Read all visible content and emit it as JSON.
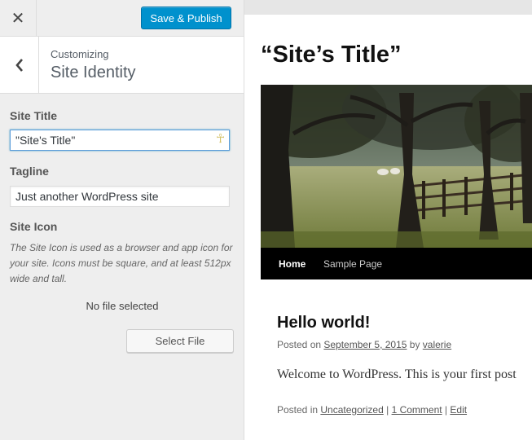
{
  "sidebar": {
    "close_icon": "close-icon",
    "publish_label": "Save & Publish",
    "back_icon": "chevron-left-icon",
    "customizing_label": "Customizing",
    "section_title": "Site Identity",
    "site_title": {
      "label": "Site Title",
      "value": "\"Site's Title\""
    },
    "tagline": {
      "label": "Tagline",
      "value": "Just another WordPress site"
    },
    "site_icon": {
      "label": "Site Icon",
      "description": "The Site Icon is used as a browser and app icon for your site. Icons must be square, and at least 512px wide and tall.",
      "status": "No file selected",
      "button_label": "Select File"
    }
  },
  "preview": {
    "site_heading": "“Site’s Title”",
    "nav": [
      "Home",
      "Sample Page"
    ],
    "post": {
      "title": "Hello world!",
      "meta_prefix": "Posted on ",
      "date": "September 5, 2015",
      "meta_by": " by ",
      "author": "valerie",
      "body": "Welcome to WordPress. This is your first post",
      "footer_prefix": "Posted in ",
      "category": "Uncategorized",
      "sep1": " | ",
      "comments": "1 Comment",
      "sep2": " | ",
      "edit": "Edit"
    }
  },
  "colors": {
    "accent": "#0091cd",
    "sidebar_bg": "#eeeeee",
    "nav_bg": "#000000"
  }
}
